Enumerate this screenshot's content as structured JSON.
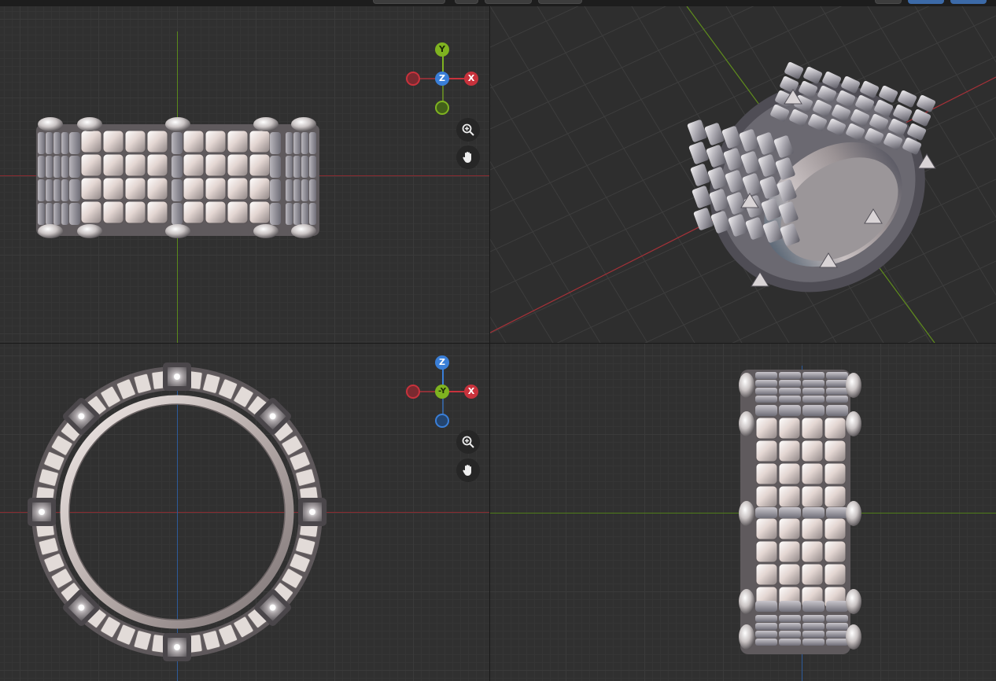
{
  "viewports": [
    {
      "id": "top",
      "view": "top",
      "gizmo": {
        "up": "Y",
        "center": "Z",
        "right": "X",
        "down": "",
        "left": ""
      }
    },
    {
      "id": "perspective",
      "view": "perspective"
    },
    {
      "id": "front",
      "view": "front",
      "gizmo": {
        "up": "Z",
        "center": "-Y",
        "right": "X",
        "down": "",
        "left": ""
      }
    },
    {
      "id": "right",
      "view": "right"
    }
  ],
  "icons": {
    "zoom": "zoom-in-icon",
    "pan": "hand-pan-icon"
  },
  "colors": {
    "viewport_bg": "#303030",
    "grid_line": "#3a3a3a",
    "axis_x": "#c8323c",
    "axis_y": "#7fb320",
    "axis_z": "#3a7fd8",
    "metal": "#d8d0cc"
  }
}
